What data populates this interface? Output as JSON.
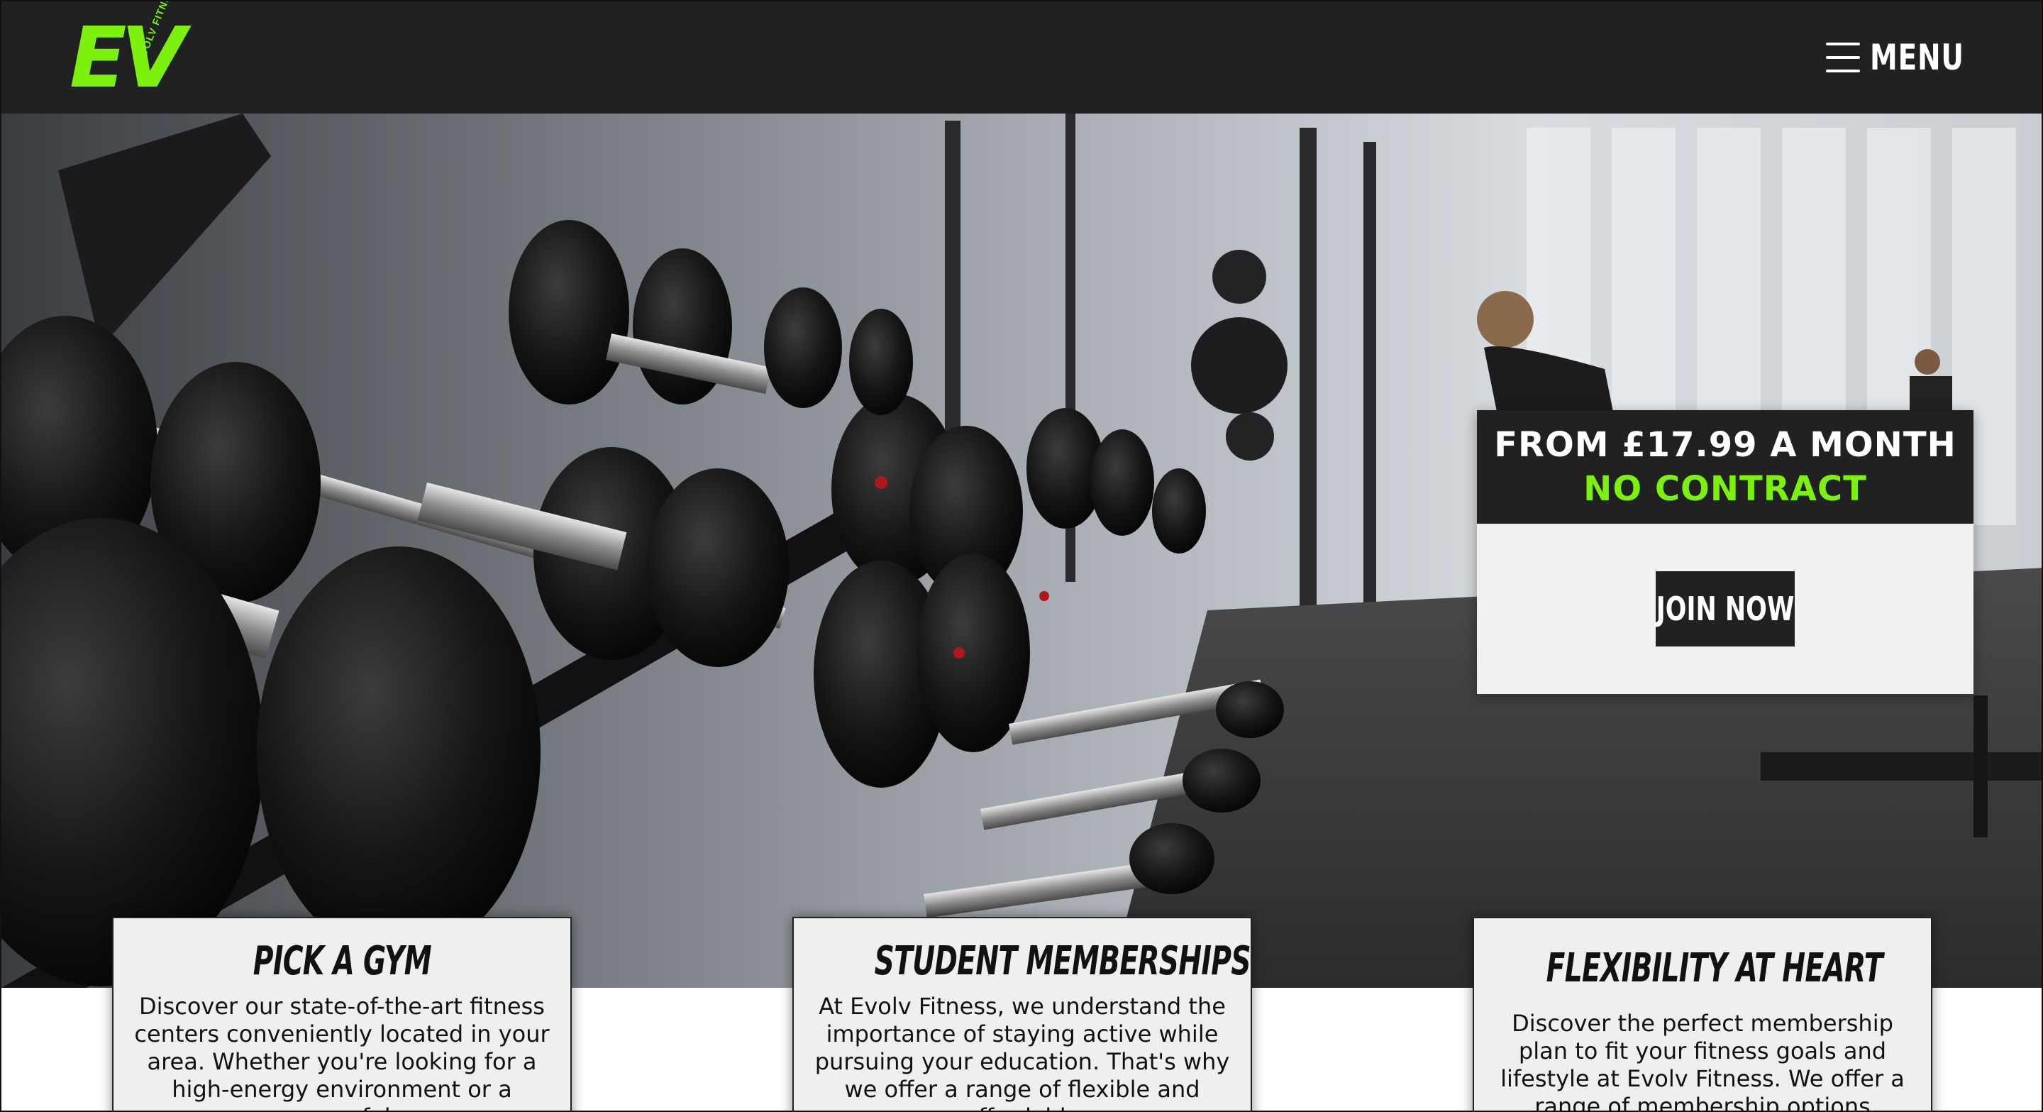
{
  "header": {
    "logo": {
      "text": "EV",
      "subtext": "EVOLV FITNESS"
    },
    "menu_label": "MENU",
    "menu_icon": "hamburger-icon"
  },
  "hero": {
    "image_description_icon": "gym-dumbbell-photo"
  },
  "offer": {
    "price_line": "FROM £17.99 A MONTH",
    "contract_line": "NO CONTRACT",
    "cta_label": "JOIN NOW"
  },
  "cards": [
    {
      "title": "PICK A GYM",
      "body": "Discover our state-of-the-art fitness centers conveniently located in your area. Whether you're looking for a high-energy environment or a peaceful"
    },
    {
      "title": "STUDENT MEMBERSHIPS",
      "body": "At Evolv Fitness, we understand the importance of staying active while pursuing your education. That's why we offer a range of flexible and affordable"
    },
    {
      "title": "FLEXIBILITY AT HEART",
      "body": "Discover the perfect membership plan to fit your fitness goals and lifestyle at Evolv Fitness. We offer a range of membership options designed to cater"
    }
  ],
  "colors": {
    "brand_green": "#7cf20c",
    "header_bg": "#212121",
    "card_bg": "#efefef"
  }
}
